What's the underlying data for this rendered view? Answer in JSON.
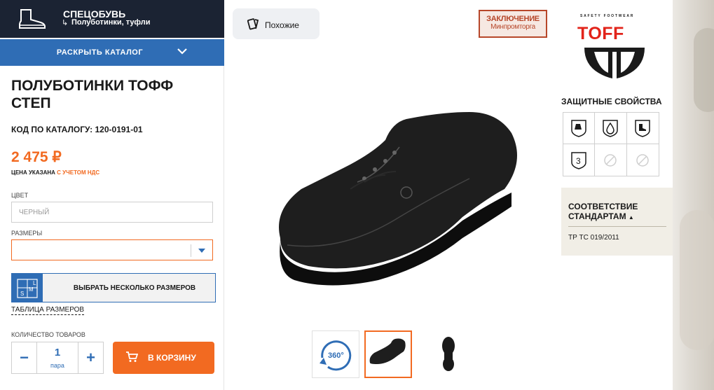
{
  "header": {
    "category_title": "СПЕЦОБУВЬ",
    "category_sub": "Полуботинки, туфли",
    "open_catalog": "РАСКРЫТЬ КАТАЛОГ"
  },
  "product": {
    "title": "ПОЛУБОТИНКИ ТОФФ СТЕП",
    "code": "КОД ПО КАТАЛОГУ: 120-0191-01",
    "price": "2 475 ₽",
    "vat_prefix": "ЦЕНА УКАЗАНА",
    "vat_highlight": "С УЧЕТОМ НДС"
  },
  "form": {
    "color_label": "ЦВЕТ",
    "color_value": "ЧЕРНЫЙ",
    "sizes_label": "РАЗМЕРЫ",
    "sizes_value": "",
    "multi_sizes": "ВЫБРАТЬ НЕСКОЛЬКО РАЗМЕРОВ",
    "size_table": "ТАБЛИЦА РАЗМЕРОВ",
    "qty_label": "КОЛИЧЕСТВО ТОВАРОВ",
    "qty_value": "1",
    "qty_unit": "пара",
    "minus": "−",
    "plus": "+",
    "cart": "В КОРЗИНУ",
    "multi_icon_letters": [
      "S",
      "M",
      "L"
    ]
  },
  "gallery": {
    "similar": "Похожие",
    "stamp_line1": "ЗАКЛЮЧЕНИЕ",
    "stamp_line2": "Минпромторга",
    "thumb_360": "360°"
  },
  "brand": {
    "tagline": "SAFETY FOOTWEAR",
    "name": "TOFF"
  },
  "protection": {
    "title": "ЗАЩИТНЫЕ СВОЙСТВА",
    "icons": [
      "chemical-icon",
      "oil-drop-icon",
      "slip-resist-icon",
      "class-3-icon",
      "disabled-icon",
      "disabled-icon"
    ],
    "class_number": "3"
  },
  "standards": {
    "title_line1": "СООТВЕТСТВИЕ",
    "title_line2": "СТАНДАРТАМ",
    "value": "ТР ТС 019/2011"
  },
  "colors": {
    "accent": "#f26a21",
    "blue": "#2f6db5",
    "dark": "#1b2333"
  }
}
